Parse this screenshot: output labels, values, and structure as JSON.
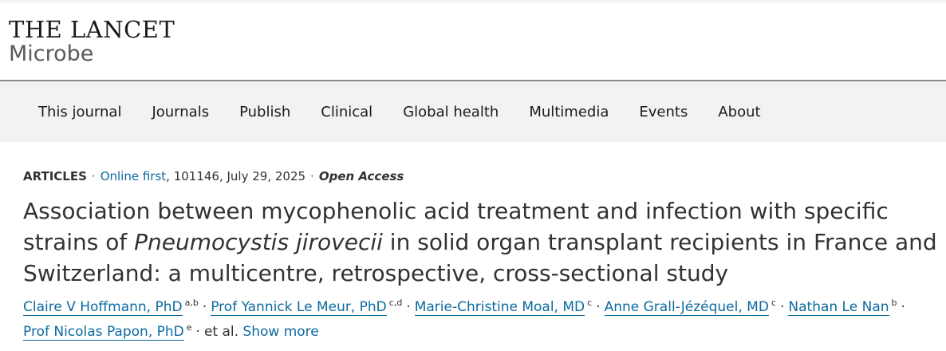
{
  "logo": {
    "line1": "THE LANCET",
    "line2": "Microbe"
  },
  "nav": {
    "items": [
      "This journal",
      "Journals",
      "Publish",
      "Clinical",
      "Global health",
      "Multimedia",
      "Events",
      "About"
    ]
  },
  "article": {
    "type": "ARTICLES",
    "online_first": "Online first",
    "meta_rest": ", 101146, July 29, 2025",
    "access": "Open Access",
    "title_part1": "Association between mycophenolic acid treatment and infection with specific strains of ",
    "title_italic": "Pneumocystis jirovecii",
    "title_part2": " in solid organ transplant recipients in France and Switzerland: a multicentre, retrospective, cross-sectional study",
    "authors": [
      {
        "name": "Claire V Hoffmann, PhD",
        "sup": "a,b"
      },
      {
        "name": "Prof Yannick Le Meur, PhD",
        "sup": "c,d"
      },
      {
        "name": "Marie-Christine Moal, MD",
        "sup": "c"
      },
      {
        "name": "Anne Grall-Jézéquel, MD",
        "sup": "c"
      },
      {
        "name": "Nathan Le Nan",
        "sup": "b"
      },
      {
        "name": "Prof Nicolas Papon, PhD",
        "sup": "e"
      }
    ],
    "separator": "·",
    "et_al": "et al.",
    "show_more": "Show more"
  },
  "colors": {
    "link": "#0c6a9f",
    "nav_bg": "#f2f2f2",
    "text": "#323232"
  }
}
